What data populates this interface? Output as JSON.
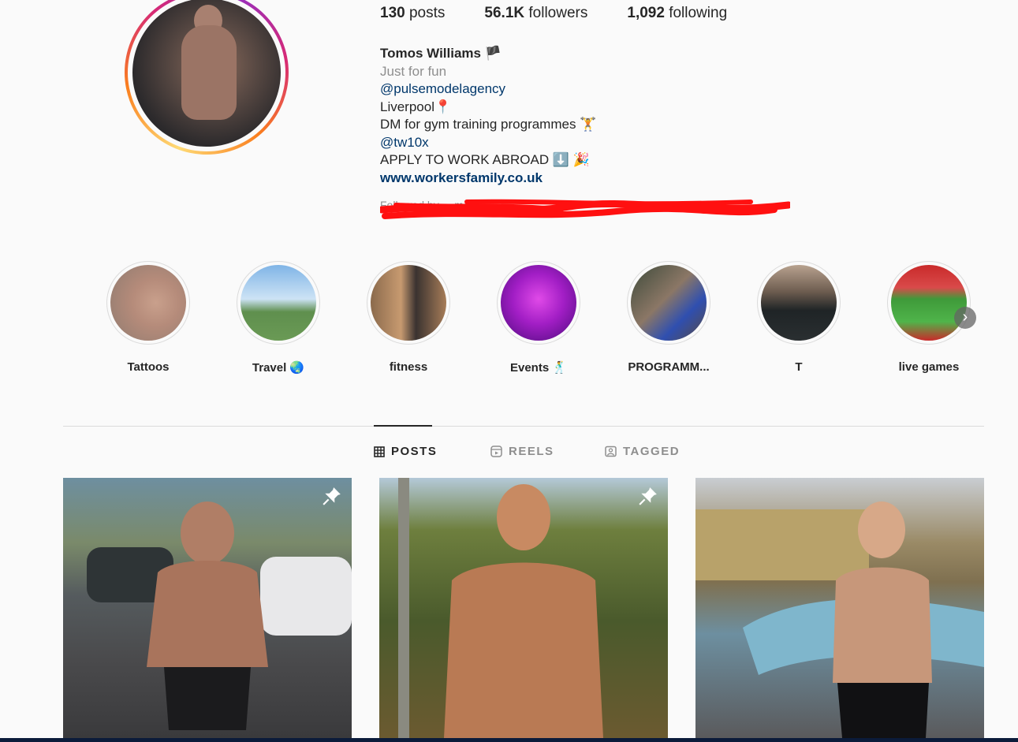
{
  "profile": {
    "stats": [
      {
        "count": "130",
        "label": "posts"
      },
      {
        "count": "56.1K",
        "label": "followers"
      },
      {
        "count": "1,092",
        "label": "following"
      }
    ],
    "name": "Tomos Williams",
    "name_emoji": "🏴",
    "bio_line1": "Just for fun",
    "bio_mention1": "@pulsemodelagency",
    "bio_location": "Liverpool📍",
    "bio_dm": "DM for gym training programmes 🏋",
    "bio_mention2": "@tw10x",
    "bio_apply": "APPLY TO WORK ABROAD ⬇️ 🎉",
    "website": "www.workersfamily.co.uk",
    "followed_by": "Followed by ... more"
  },
  "highlights": [
    {
      "label": "Tattoos"
    },
    {
      "label": "Travel 🌏"
    },
    {
      "label": "fitness"
    },
    {
      "label": "Events 🕺"
    },
    {
      "label": "PROGRAMM..."
    },
    {
      "label": "T"
    },
    {
      "label": "live games"
    }
  ],
  "tabs": [
    {
      "label": "POSTS",
      "active": true
    },
    {
      "label": "REELS",
      "active": false
    },
    {
      "label": "TAGGED",
      "active": false
    }
  ],
  "posts": [
    {
      "pinned": true,
      "icon": "pin-icon"
    },
    {
      "pinned": true,
      "icon": "pin-icon"
    },
    {
      "pinned": false
    }
  ],
  "colors": {
    "background": "#fafafa",
    "text": "#262626",
    "muted": "#8e8e8e",
    "link": "#00376b",
    "redaction": "#ff0000"
  }
}
